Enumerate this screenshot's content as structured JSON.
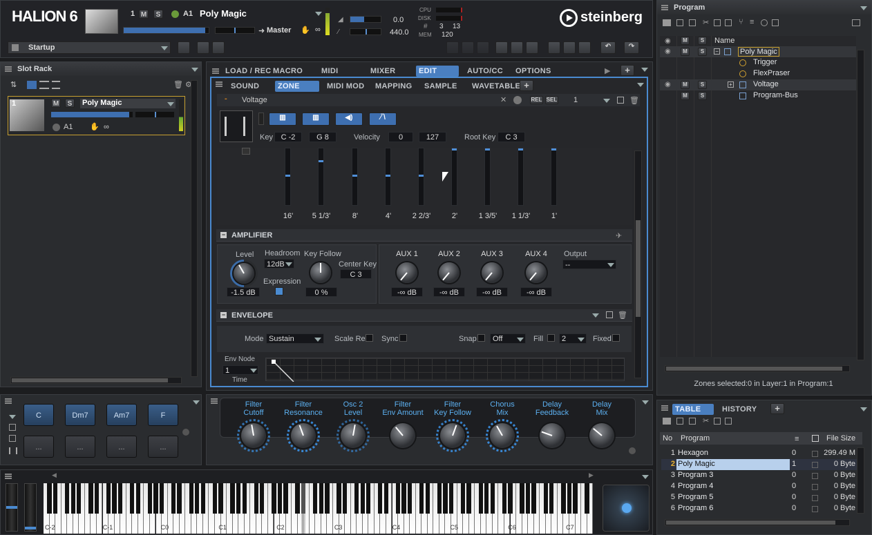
{
  "header": {
    "logo": "HALION 6",
    "slot_num": "1",
    "m": "M",
    "s": "S",
    "midi": "A1",
    "program": "Poly Magic",
    "volume": "0.0",
    "tune": "440.0",
    "output": "Master",
    "inf": "∞",
    "cpu": "CPU",
    "disk": "DISK",
    "hash": "#",
    "mem": "MEM",
    "voices": "3",
    "voices_max": "13",
    "mem_val": "120",
    "preset": "Startup",
    "brand": "steinberg"
  },
  "slotrack": {
    "title": "Slot Rack",
    "slot": {
      "num": "1",
      "m": "M",
      "s": "S",
      "name": "Poly Magic",
      "midi": "A1",
      "inf": "∞"
    }
  },
  "tabs": {
    "main": [
      "LOAD / REC",
      "MACRO",
      "MIDI",
      "MIXER",
      "EDIT",
      "AUTO/CC",
      "OPTIONS"
    ],
    "sub": [
      "SOUND",
      "ZONE",
      "MIDI MOD",
      "MAPPING",
      "SAMPLE",
      "WAVETABLE"
    ],
    "add": "+"
  },
  "zone": {
    "name": "Voltage",
    "rel": "REL",
    "sel": "SEL",
    "num": "1",
    "key_label": "Key",
    "key_lo": "C -2",
    "key_hi": "G 8",
    "vel_label": "Velocity",
    "vel_lo": "0",
    "vel_hi": "127",
    "root_label": "Root Key",
    "root": "C 3"
  },
  "drawbars": {
    "labels": [
      "16'",
      "5 1/3'",
      "8'",
      "4'",
      "2 2/3'",
      "2'",
      "1 3/5'",
      "1 1/3'",
      "1'"
    ],
    "levels": [
      0.45,
      0.2,
      0.45,
      0.45,
      0.45,
      0.0,
      0.0,
      0.0,
      0.0
    ]
  },
  "amplifier": {
    "title": "AMPLIFIER",
    "level_label": "Level",
    "level": "-1.5 dB",
    "headroom_label": "Headroom",
    "headroom": "12dB",
    "expression_label": "Expression",
    "keyfollow_label": "Key Follow",
    "keyfollow": "0 %",
    "center_label": "Center Key",
    "center": "C 3",
    "aux": [
      {
        "label": "AUX 1",
        "value": "-∞ dB"
      },
      {
        "label": "AUX 2",
        "value": "-∞ dB"
      },
      {
        "label": "AUX 3",
        "value": "-∞ dB"
      },
      {
        "label": "AUX 4",
        "value": "-∞ dB"
      }
    ],
    "output_label": "Output",
    "output": "--"
  },
  "envelope": {
    "title": "ENVELOPE",
    "mode_label": "Mode",
    "mode": "Sustain",
    "scalerel": "Scale Rel",
    "sync": "Sync",
    "snap": "Snap",
    "snap_val": "Off",
    "fill": "Fill",
    "fill_val": "2",
    "fixed": "Fixed",
    "envnode": "Env Node",
    "envnode_val": "1",
    "time": "Time"
  },
  "pads": {
    "row1": [
      "C",
      "Dm7",
      "Am7",
      "F"
    ],
    "row2": [
      "...",
      "...",
      "...",
      "..."
    ]
  },
  "quick": [
    {
      "l1": "Filter",
      "l2": "Cutoff"
    },
    {
      "l1": "Filter",
      "l2": "Resonance"
    },
    {
      "l1": "Osc 2",
      "l2": "Level"
    },
    {
      "l1": "Filter",
      "l2": "Env Amount"
    },
    {
      "l1": "Filter",
      "l2": "Key Follow"
    },
    {
      "l1": "Chorus",
      "l2": "Mix"
    },
    {
      "l1": "Delay",
      "l2": "Feedback"
    },
    {
      "l1": "Delay",
      "l2": "Mix"
    }
  ],
  "keyboard": {
    "octaves": [
      "C-2",
      "C-1",
      "C0",
      "C1",
      "C2",
      "C3",
      "C4",
      "C5",
      "C6",
      "C7"
    ]
  },
  "program": {
    "title": "Program",
    "name_col": "Name",
    "tree": [
      {
        "name": "Poly Magic",
        "type": "program"
      },
      {
        "name": "Trigger",
        "type": "module"
      },
      {
        "name": "FlexPraser",
        "type": "module"
      },
      {
        "name": "Voltage",
        "type": "layer"
      },
      {
        "name": "Program-Bus",
        "type": "bus"
      }
    ],
    "status": "Zones selected:0  in Layer:1  in Program:1"
  },
  "table": {
    "tabs": [
      "TABLE",
      "HISTORY"
    ],
    "add": "+",
    "cols": [
      "No",
      "Program",
      "",
      "",
      "File Size"
    ],
    "rows": [
      {
        "no": "1",
        "name": "Hexagon",
        "n": "0",
        "size": "299.49 M"
      },
      {
        "no": "2",
        "name": "Poly Magic",
        "n": "1",
        "size": "0 Byte"
      },
      {
        "no": "3",
        "name": "Program 3",
        "n": "0",
        "size": "0 Byte"
      },
      {
        "no": "4",
        "name": "Program 4",
        "n": "0",
        "size": "0 Byte"
      },
      {
        "no": "5",
        "name": "Program 5",
        "n": "0",
        "size": "0 Byte"
      },
      {
        "no": "6",
        "name": "Program 6",
        "n": "0",
        "size": "0 Byte"
      }
    ]
  }
}
